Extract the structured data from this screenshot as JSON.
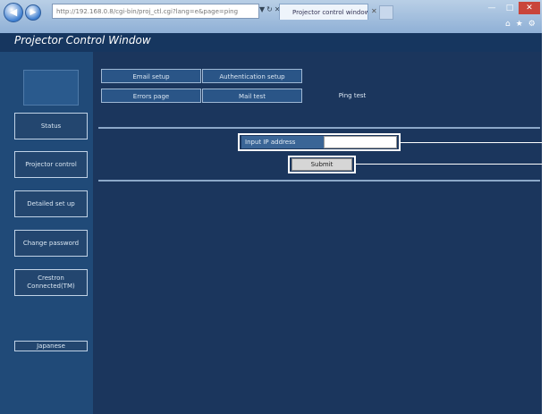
{
  "browser": {
    "address": "http://192.168.0.8/cgi-bin/proj_ctl.cgi?lang=e&page=ping",
    "tab_title": "Projector control window",
    "back_icon": "back-arrow-icon",
    "forward_icon": "forward-arrow-icon"
  },
  "app": {
    "window_title": "Projector Control Window"
  },
  "sidebar": {
    "items": [
      {
        "label": "Status"
      },
      {
        "label": "Projector control"
      },
      {
        "label": "Detailed set up"
      },
      {
        "label": "Change password"
      },
      {
        "label": "Crestron Connected(TM)"
      },
      {
        "label": "Japanese"
      }
    ]
  },
  "tabs": [
    {
      "label": "Email setup"
    },
    {
      "label": "Authentication setup"
    },
    {
      "label": "Errors page"
    },
    {
      "label": "Mail test"
    },
    {
      "label": "Ping test"
    }
  ],
  "form": {
    "ip_label": "Input IP address",
    "ip_value": "",
    "submit_label": "Submit"
  },
  "colors": {
    "title_bar": "#16365f",
    "content_bg": "#1b365d",
    "sidebar_bg": "#204a78",
    "callout": "#ffffff"
  }
}
